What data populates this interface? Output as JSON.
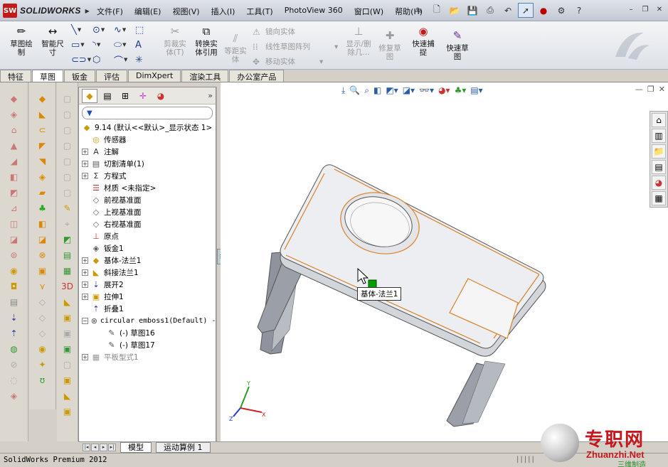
{
  "app": {
    "logo_text": "SOLIDWORKS",
    "logo_mark": "SW"
  },
  "menu": [
    "文件(F)",
    "编辑(E)",
    "视图(V)",
    "插入(I)",
    "工具(T)",
    "PhotoView 360",
    "窗口(W)",
    "帮助(H)"
  ],
  "commands": {
    "sketch": "草图绘\n制",
    "smart_dim": "智能尺\n寸",
    "trim": "剪裁实\n体(T)",
    "convert": "转换实\n体引用",
    "offset": "等距实\n体",
    "mirror": "镜向实体",
    "linear_pattern": "线性草图阵列",
    "move": "移动实体",
    "show_delete": "显示/删\n除几...",
    "repair": "修复草\n图",
    "quick_snap": "快速捕\n捉",
    "rapid_sketch": "快速草\n图"
  },
  "tabs": [
    "特征",
    "草图",
    "钣金",
    "评估",
    "DimXpert",
    "渲染工具",
    "办公室产品"
  ],
  "active_tab": 1,
  "feature_tree": {
    "root": "9.14  (默认<<默认>_显示状态 1>",
    "items": [
      {
        "label": "传感器",
        "icon": "sensor-icon",
        "expandable": false
      },
      {
        "label": "注解",
        "icon": "annotation-icon",
        "expandable": true
      },
      {
        "label": "切割清单(1)",
        "icon": "cutlist-icon",
        "expandable": true
      },
      {
        "label": "方程式",
        "icon": "equation-icon",
        "expandable": true
      },
      {
        "label": "材质 <未指定>",
        "icon": "material-icon",
        "expandable": false
      },
      {
        "label": "前视基准面",
        "icon": "plane-icon",
        "expandable": false
      },
      {
        "label": "上视基准面",
        "icon": "plane-icon",
        "expandable": false
      },
      {
        "label": "右视基准面",
        "icon": "plane-icon",
        "expandable": false
      },
      {
        "label": "原点",
        "icon": "origin-icon",
        "expandable": false
      },
      {
        "label": "钣金1",
        "icon": "sheetmetal-icon",
        "expandable": false
      },
      {
        "label": "基体-法兰1",
        "icon": "base-flange-icon",
        "expandable": true
      },
      {
        "label": "斜接法兰1",
        "icon": "miter-flange-icon",
        "expandable": true
      },
      {
        "label": "展开2",
        "icon": "unfold-icon",
        "expandable": true
      },
      {
        "label": "拉伸1",
        "icon": "extrude-icon",
        "expandable": true
      },
      {
        "label": "折叠1",
        "icon": "fold-icon",
        "expandable": false
      },
      {
        "label": "circular emboss1(Default) -",
        "icon": "emboss-icon",
        "expandable": true,
        "expanded": true,
        "mono": true
      },
      {
        "label": "(-) 草图16",
        "icon": "sketch-icon",
        "expandable": false,
        "indent": 1
      },
      {
        "label": "(-) 草图17",
        "icon": "sketch-icon",
        "expandable": false,
        "indent": 1
      },
      {
        "label": "平板型式1",
        "icon": "flat-pattern-icon",
        "expandable": true,
        "rolled_back": true
      }
    ]
  },
  "tooltip": "基体-法兰1",
  "model_tabs": [
    "模型",
    "运动算例 1"
  ],
  "status": "SolidWorks Premium 2012",
  "status_dots": "|||||",
  "watermark": {
    "cn": "专职网",
    "en": "Zhuanzhi.Net",
    "sub": "三维制造"
  },
  "colors": {
    "edge": "#d9822b",
    "selection": "#00a000",
    "accent": "#c2191b"
  }
}
